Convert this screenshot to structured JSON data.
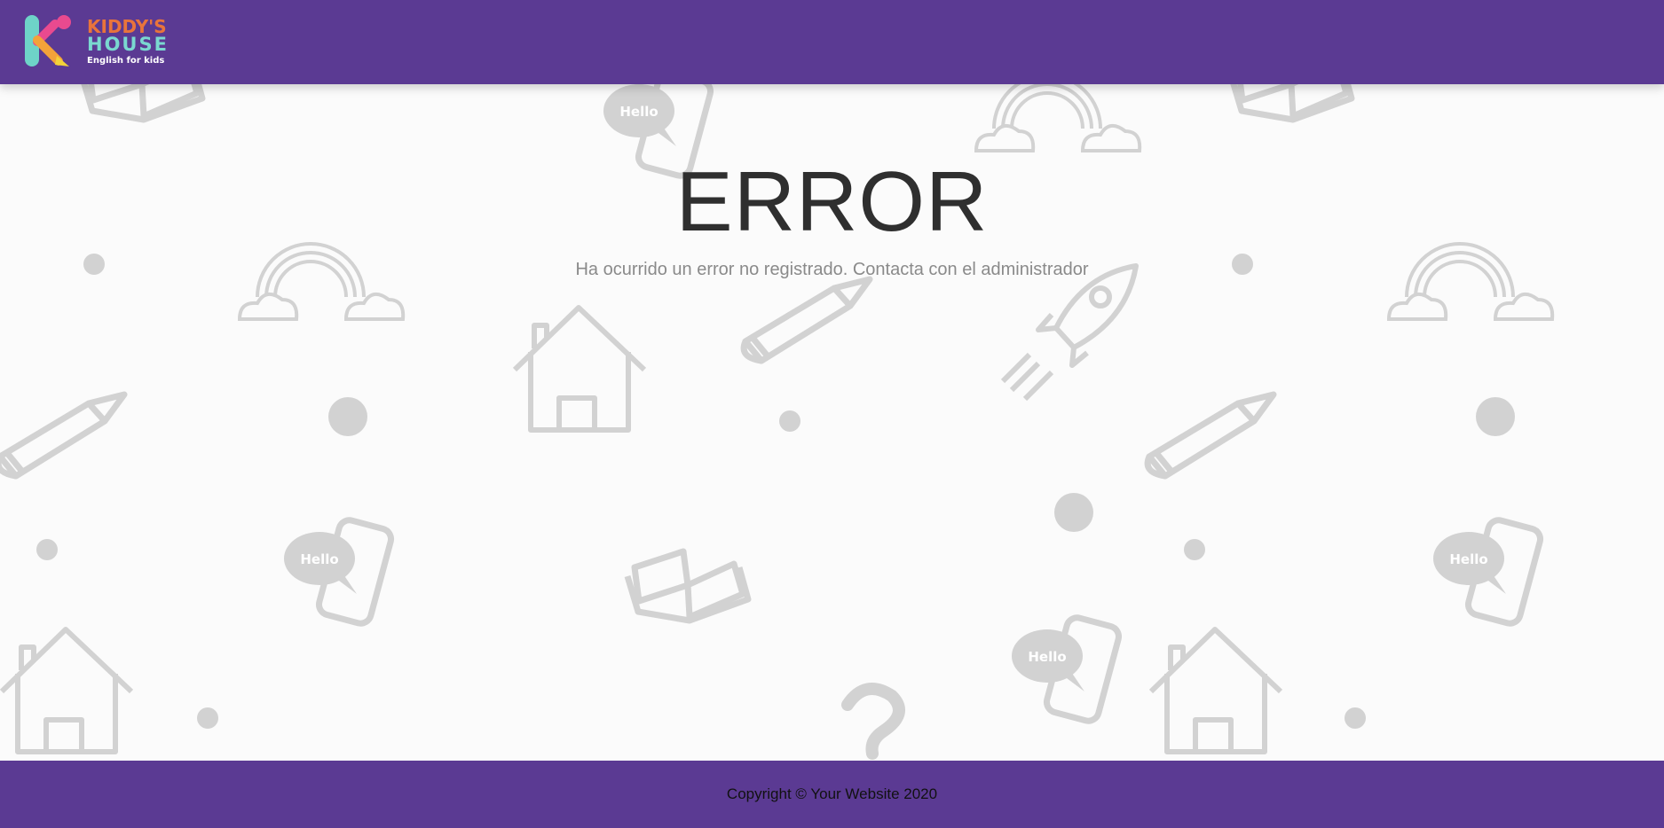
{
  "brand": {
    "line1": "KIDDY'S",
    "line2": "HOUSE",
    "tagline": "English for kids",
    "colors": {
      "k_teal": "#6ed3c8",
      "k_pink": "#e94a8f",
      "k_orange": "#f3a23a",
      "line1": "#e9743b",
      "line2": "#7ad8d0",
      "tagline": "#ffffff"
    }
  },
  "header": {
    "background": "#5b3a93"
  },
  "error": {
    "title": "ERROR",
    "message": "Ha ocurrido un error no registrado. Contacta con el administrador"
  },
  "background_pattern": {
    "icons": [
      "book-icon",
      "phone-hello-icon",
      "rainbow-icon",
      "house-icon",
      "pencil-icon",
      "rocket-icon",
      "question-mark-icon",
      "dot"
    ],
    "speech_bubble_text": "Hello",
    "icon_color": "#cfcfcf"
  },
  "footer": {
    "copyright": "Copyright © Your Website 2020",
    "background": "#5b3a93"
  }
}
